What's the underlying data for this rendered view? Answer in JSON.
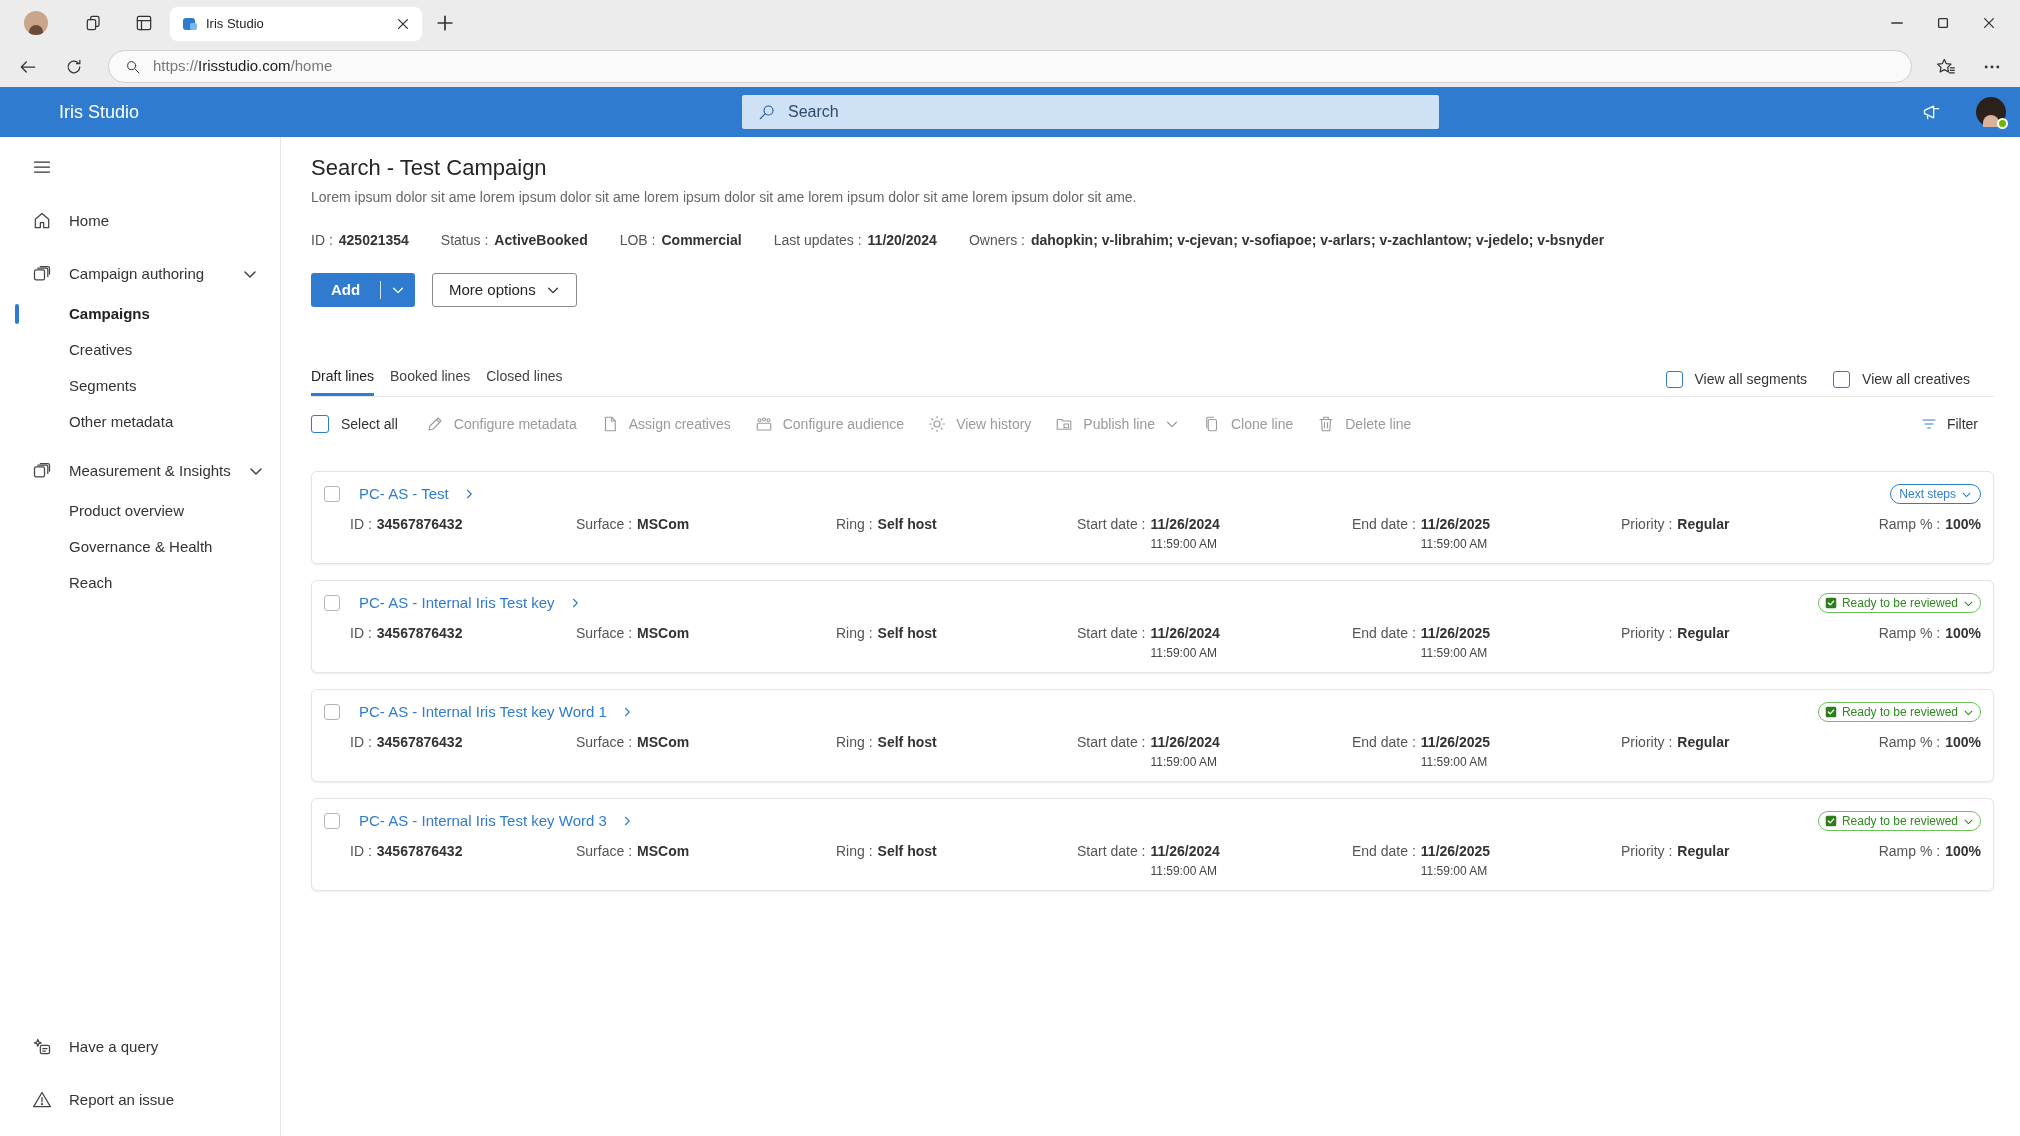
{
  "browser": {
    "tab_title": "Iris Studio",
    "url_scheme": "https://",
    "url_host": "Irisstudio.com",
    "url_path": "/home"
  },
  "app": {
    "title": "Iris Studio",
    "search_placeholder": "Search"
  },
  "sidebar": {
    "items": [
      {
        "label": "Home",
        "kind": "home"
      },
      {
        "label": "Campaign authoring",
        "kind": "stack",
        "expanded": true,
        "children": [
          {
            "label": "Campaigns",
            "selected": true
          },
          {
            "label": "Creatives",
            "selected": false
          },
          {
            "label": "Segments",
            "selected": false
          },
          {
            "label": "Other metadata",
            "selected": false
          }
        ]
      },
      {
        "label": "Measurement & Insights",
        "kind": "stack",
        "expanded": true,
        "children": [
          {
            "label": "Product overview",
            "selected": false
          },
          {
            "label": "Governance & Health",
            "selected": false
          },
          {
            "label": "Reach",
            "selected": false
          }
        ]
      }
    ],
    "footer": [
      {
        "label": "Have a query",
        "kind": "query"
      },
      {
        "label": "Report an issue",
        "kind": "warning"
      }
    ]
  },
  "page": {
    "title": "Search - Test Campaign",
    "description": "Lorem ipsum dolor sit ame lorem ipsum dolor sit ame lorem ipsum dolor sit ame lorem ipsum dolor sit ame lorem ipsum dolor sit ame.",
    "meta": [
      {
        "label": "ID :",
        "value": "425021354"
      },
      {
        "label": "Status :",
        "value": "ActiveBooked"
      },
      {
        "label": "LOB :",
        "value": "Commercial"
      },
      {
        "label": "Last updates :",
        "value": "11/20/2024"
      },
      {
        "label": "Owners :",
        "value": "dahopkin; v-librahim; v-cjevan; v-sofiapoe; v-arlars; v-zachlantow; v-jedelo; v-bsnyder"
      }
    ],
    "add_button": "Add",
    "more_button": "More options"
  },
  "tabs": [
    {
      "label": "Draft lines",
      "selected": true
    },
    {
      "label": "Booked lines",
      "selected": false
    },
    {
      "label": "Closed lines",
      "selected": false
    }
  ],
  "view_options": [
    {
      "label": "View all segments",
      "checked": false
    },
    {
      "label": "View all creatives",
      "checked": false
    }
  ],
  "toolbar": {
    "select_all": {
      "label": "Select all",
      "checked": false
    },
    "actions": [
      {
        "label": "Configure metadata",
        "kind": "pencil",
        "disabled": true
      },
      {
        "label": "Assign creatives",
        "kind": "document",
        "disabled": true
      },
      {
        "label": "Configure audience",
        "kind": "people",
        "disabled": true
      },
      {
        "label": "View history",
        "kind": "history",
        "disabled": true
      },
      {
        "label": "Publish line",
        "kind": "publish",
        "disabled": true
      },
      {
        "label": "Clone line",
        "kind": "copy",
        "disabled": true
      },
      {
        "label": "Delete line",
        "kind": "trash",
        "disabled": true
      }
    ],
    "filter": "Filter"
  },
  "lines": [
    {
      "name": "PC- AS - Test",
      "checked": false,
      "status": {
        "label": "Next steps",
        "kind": "next"
      },
      "fields": [
        {
          "label": "ID :",
          "value": "34567876432"
        },
        {
          "label": "Surface :",
          "value": "MSCom"
        },
        {
          "label": "Ring :",
          "value": "Self host"
        },
        {
          "label": "Start date :",
          "value": "11/26/2024",
          "time": "11:59:00 AM"
        },
        {
          "label": "End date :",
          "value": "11/26/2025",
          "time": "11:59:00 AM"
        },
        {
          "label": "Priority :",
          "value": "Regular"
        },
        {
          "label": "Ramp % :",
          "value": "100%"
        }
      ]
    },
    {
      "name": "PC- AS - Internal Iris Test key",
      "checked": false,
      "status": {
        "label": "Ready to be reviewed",
        "kind": "ready"
      },
      "fields": [
        {
          "label": "ID :",
          "value": "34567876432"
        },
        {
          "label": "Surface :",
          "value": "MSCom"
        },
        {
          "label": "Ring :",
          "value": "Self host"
        },
        {
          "label": "Start date :",
          "value": "11/26/2024",
          "time": "11:59:00 AM"
        },
        {
          "label": "End date :",
          "value": "11/26/2025",
          "time": "11:59:00 AM"
        },
        {
          "label": "Priority :",
          "value": "Regular"
        },
        {
          "label": "Ramp % :",
          "value": "100%"
        }
      ]
    },
    {
      "name": "PC- AS - Internal Iris Test key Word 1",
      "checked": false,
      "status": {
        "label": "Ready to be reviewed",
        "kind": "ready"
      },
      "fields": [
        {
          "label": "ID :",
          "value": "34567876432"
        },
        {
          "label": "Surface :",
          "value": "MSCom"
        },
        {
          "label": "Ring :",
          "value": "Self host"
        },
        {
          "label": "Start date :",
          "value": "11/26/2024",
          "time": "11:59:00 AM"
        },
        {
          "label": "End date :",
          "value": "11/26/2025",
          "time": "11:59:00 AM"
        },
        {
          "label": "Priority :",
          "value": "Regular"
        },
        {
          "label": "Ramp % :",
          "value": "100%"
        }
      ]
    },
    {
      "name": "PC- AS - Internal Iris Test key Word 3",
      "checked": false,
      "status": {
        "label": "Ready to be reviewed",
        "kind": "ready"
      },
      "fields": [
        {
          "label": "ID :",
          "value": "34567876432"
        },
        {
          "label": "Surface :",
          "value": "MSCom"
        },
        {
          "label": "Ring :",
          "value": "Self host"
        },
        {
          "label": "Start date :",
          "value": "11/26/2024",
          "time": "11:59:00 AM"
        },
        {
          "label": "End date :",
          "value": "11/26/2025",
          "time": "11:59:00 AM"
        },
        {
          "label": "Priority :",
          "value": "Regular"
        },
        {
          "label": "Ramp % :",
          "value": "100%"
        }
      ]
    }
  ]
}
